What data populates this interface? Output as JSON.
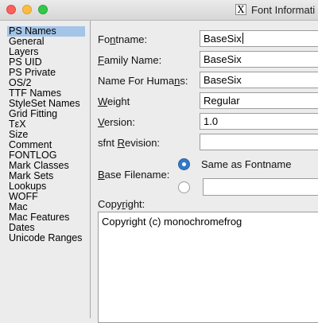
{
  "window": {
    "title": "Font Informati",
    "app_icon": "x11-icon"
  },
  "sidebar": {
    "items": [
      {
        "label": "PS Names",
        "selected": true
      },
      {
        "label": "General"
      },
      {
        "label": "Layers"
      },
      {
        "label": "PS UID"
      },
      {
        "label": "PS Private"
      },
      {
        "label": "OS/2"
      },
      {
        "label": "TTF Names"
      },
      {
        "label": "StyleSet Names"
      },
      {
        "label": "Grid Fitting"
      },
      {
        "label": "TεX"
      },
      {
        "label": "Size"
      },
      {
        "label": "Comment"
      },
      {
        "label": "FONTLOG"
      },
      {
        "label": "Mark Classes"
      },
      {
        "label": "Mark Sets"
      },
      {
        "label": "Lookups"
      },
      {
        "label": "WOFF"
      },
      {
        "label": "Mac"
      },
      {
        "label": "Mac Features"
      },
      {
        "label": "Dates"
      },
      {
        "label": "Unicode Ranges"
      }
    ]
  },
  "form": {
    "fontname": {
      "label_a": "Fo",
      "label_u": "n",
      "label_b": "tname:",
      "value": "BaseSix"
    },
    "family_name": {
      "label_a": "",
      "label_u": "F",
      "label_b": "amily Name:",
      "value": "BaseSix"
    },
    "name_for_humans": {
      "label_a": "Name For Huma",
      "label_u": "n",
      "label_b": "s:",
      "value": "BaseSix"
    },
    "weight": {
      "label_a": "",
      "label_u": "W",
      "label_b": "eight",
      "value": "Regular"
    },
    "version": {
      "label_a": "",
      "label_u": "V",
      "label_b": "ersion:",
      "value": "1.0"
    },
    "sfnt_revision": {
      "label_a": "sfnt ",
      "label_u": "R",
      "label_b": "evision:",
      "value": ""
    },
    "base_filename": {
      "label_a": "",
      "label_u": "B",
      "label_b": "ase Filename:",
      "option_same": "Same as Fontname",
      "custom_value": ""
    },
    "copyright": {
      "label_a": "Copy",
      "label_u": "r",
      "label_b": "ight:",
      "value": "Copyright (c) monochromefrog"
    }
  }
}
